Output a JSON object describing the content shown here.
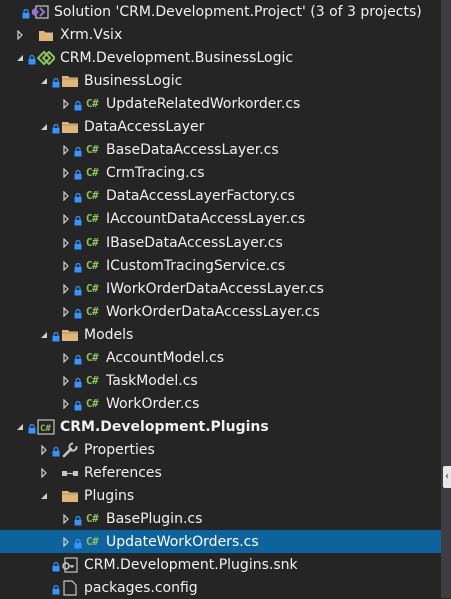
{
  "colors": {
    "background": "#252526",
    "selection": "#0e639c",
    "csharp_glyph": "#8ec25f",
    "folder": "#dcb67a",
    "lock": "#3794ff",
    "vs_purple": "#9b72cf"
  },
  "tree": {
    "rows": [
      {
        "label": "Solution 'CRM.Development.Project' (3 of 3 projects)",
        "icon": "solution-icon",
        "expander": "none",
        "lock": true,
        "level": 0
      },
      {
        "label": "Xrm.Vsix",
        "icon": "vsix-project-icon",
        "expander": "collapsed",
        "lock": false,
        "level": 1
      },
      {
        "label": "CRM.Development.BusinessLogic",
        "icon": "shared-project-icon",
        "expander": "expanded",
        "lock": true,
        "level": 1
      },
      {
        "label": "BusinessLogic",
        "icon": "folder-icon",
        "expander": "expanded",
        "lock": true,
        "level": 2
      },
      {
        "label": "UpdateRelatedWorkorder.cs",
        "icon": "csharp-file-icon",
        "expander": "collapsed",
        "lock": true,
        "level": 3
      },
      {
        "label": "DataAccessLayer",
        "icon": "folder-icon",
        "expander": "expanded",
        "lock": true,
        "level": 2
      },
      {
        "label": "BaseDataAccessLayer.cs",
        "icon": "csharp-file-icon",
        "expander": "collapsed",
        "lock": true,
        "level": 3
      },
      {
        "label": "CrmTracing.cs",
        "icon": "csharp-file-icon",
        "expander": "collapsed",
        "lock": true,
        "level": 3
      },
      {
        "label": "DataAccessLayerFactory.cs",
        "icon": "csharp-file-icon",
        "expander": "collapsed",
        "lock": true,
        "level": 3
      },
      {
        "label": "IAccountDataAccessLayer.cs",
        "icon": "csharp-file-icon",
        "expander": "collapsed",
        "lock": true,
        "level": 3
      },
      {
        "label": "IBaseDataAccessLayer.cs",
        "icon": "csharp-file-icon",
        "expander": "collapsed",
        "lock": true,
        "level": 3
      },
      {
        "label": "ICustomTracingService.cs",
        "icon": "csharp-file-icon",
        "expander": "collapsed",
        "lock": true,
        "level": 3
      },
      {
        "label": "IWorkOrderDataAccessLayer.cs",
        "icon": "csharp-file-icon",
        "expander": "collapsed",
        "lock": true,
        "level": 3
      },
      {
        "label": "WorkOrderDataAccessLayer.cs",
        "icon": "csharp-file-icon",
        "expander": "collapsed",
        "lock": true,
        "level": 3
      },
      {
        "label": "Models",
        "icon": "folder-icon",
        "expander": "expanded",
        "lock": true,
        "level": 2
      },
      {
        "label": "AccountModel.cs",
        "icon": "csharp-file-icon",
        "expander": "collapsed",
        "lock": true,
        "level": 3
      },
      {
        "label": "TaskModel.cs",
        "icon": "csharp-file-icon",
        "expander": "collapsed",
        "lock": true,
        "level": 3
      },
      {
        "label": "WorkOrder.cs",
        "icon": "csharp-file-icon",
        "expander": "collapsed",
        "lock": true,
        "level": 3
      },
      {
        "label": "CRM.Development.Plugins",
        "icon": "csharp-project-icon",
        "expander": "expanded",
        "lock": true,
        "level": 1,
        "bold": true
      },
      {
        "label": "Properties",
        "icon": "wrench-icon",
        "expander": "collapsed",
        "lock": true,
        "level": 2
      },
      {
        "label": "References",
        "icon": "references-icon",
        "expander": "collapsed",
        "lock": false,
        "level": 2
      },
      {
        "label": "Plugins",
        "icon": "folder-icon",
        "expander": "expanded",
        "lock": false,
        "level": 2
      },
      {
        "label": "BasePlugin.cs",
        "icon": "csharp-file-icon",
        "expander": "collapsed",
        "lock": true,
        "level": 3
      },
      {
        "label": "UpdateWorkOrders.cs",
        "icon": "csharp-file-icon",
        "expander": "collapsed",
        "lock": true,
        "level": 3,
        "selected": true
      },
      {
        "label": "CRM.Development.Plugins.snk",
        "icon": "key-file-icon",
        "expander": "none",
        "lock": true,
        "level": 2
      },
      {
        "label": "packages.config",
        "icon": "config-file-icon",
        "expander": "none",
        "lock": true,
        "level": 2
      }
    ]
  },
  "scroll_tab": {
    "glyph": "‹"
  }
}
